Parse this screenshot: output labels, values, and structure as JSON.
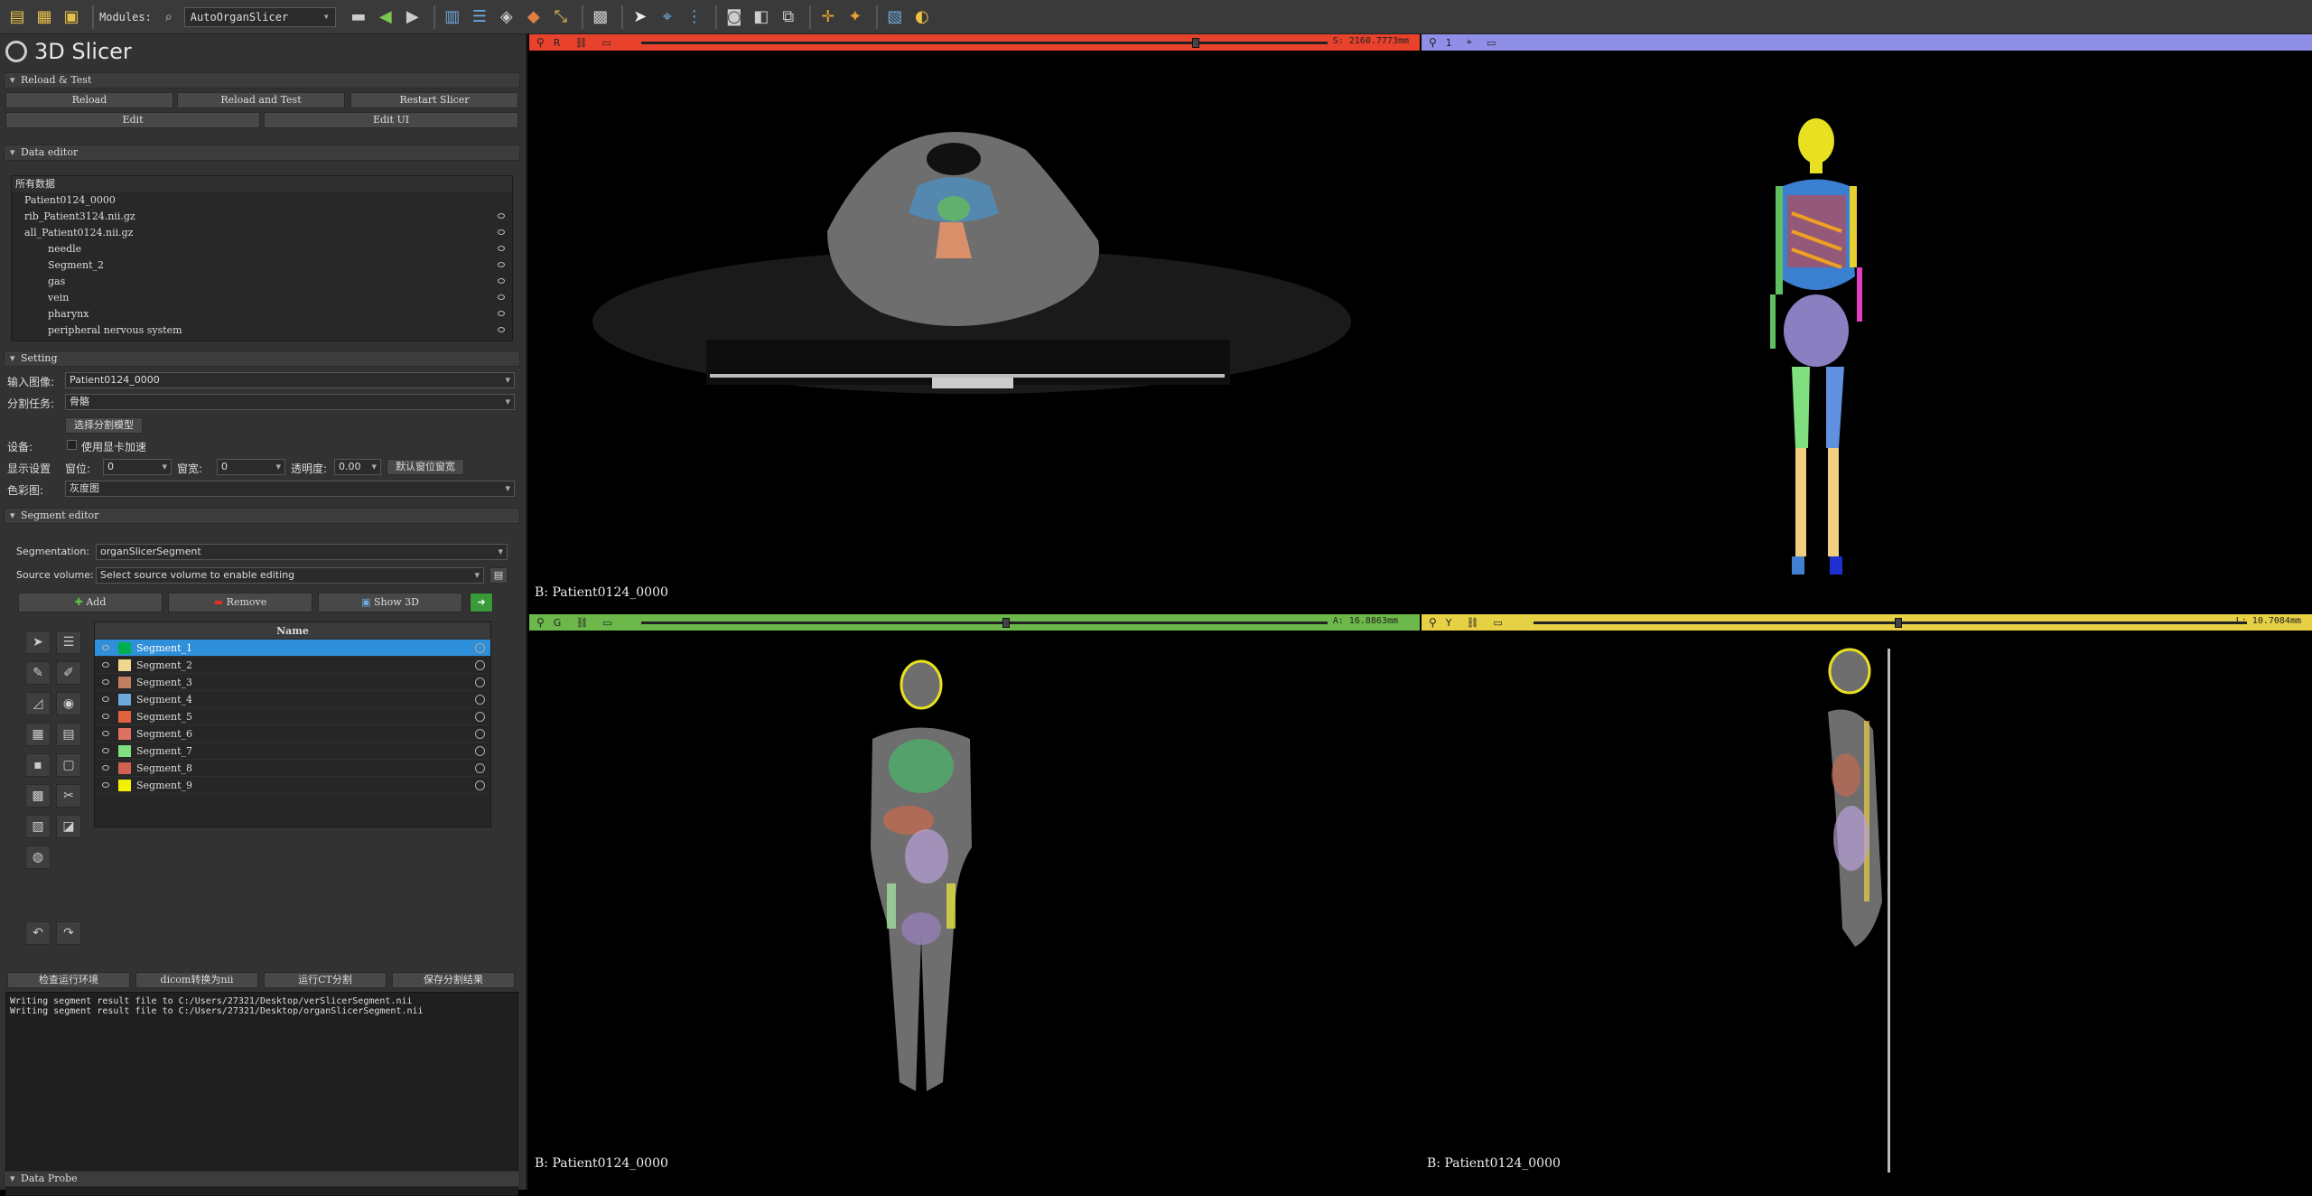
{
  "toolbar": {
    "modules_label": "Modules:",
    "module_name": "AutoOrganSlicer"
  },
  "app": {
    "title": "3D Slicer"
  },
  "reload": {
    "header": "Reload & Test",
    "reload": "Reload",
    "reload_test": "Reload and Test",
    "restart": "Restart Slicer",
    "edit": "Edit",
    "edit_ui": "Edit UI"
  },
  "data_editor": {
    "header": "Data editor",
    "root": "所有数据",
    "items": [
      {
        "label": "Patient0124_0000"
      },
      {
        "label": "rib_Patient3124.nii.gz"
      },
      {
        "label": "all_Patient0124.nii.gz"
      },
      {
        "label": "needle"
      },
      {
        "label": "Segment_2"
      },
      {
        "label": "gas"
      },
      {
        "label": "vein"
      },
      {
        "label": "pharynx"
      },
      {
        "label": "peripheral nervous system"
      }
    ]
  },
  "setting": {
    "header": "Setting",
    "input_label": "输入图像:",
    "input_value": "Patient0124_0000",
    "task_label": "分割任务:",
    "task_value": "骨骼",
    "choose_model": "选择分割模型",
    "device_label": "设备:",
    "gpu_label": "使用显卡加速",
    "display_label": "显示设置",
    "window_level_label": "窗位:",
    "window_level_value": "0",
    "window_width_label": "窗宽:",
    "window_width_value": "0",
    "opacity_label": "透明度:",
    "opacity_value": "0.00",
    "default_btn": "默认窗位窗宽",
    "colormap_label": "色彩图:",
    "colormap_value": "灰度图"
  },
  "segment_editor": {
    "header": "Segment editor",
    "segmentation_label": "Segmentation:",
    "segmentation_value": "organSlicerSegment",
    "source_label": "Source volume:",
    "source_value": "Select source volume to enable editing",
    "add": "Add",
    "remove": "Remove",
    "show3d": "Show 3D",
    "name_col": "Name",
    "segments": [
      {
        "name": "Segment_1",
        "color": "#00b050"
      },
      {
        "name": "Segment_2",
        "color": "#f0d68f"
      },
      {
        "name": "Segment_3",
        "color": "#c08060"
      },
      {
        "name": "Segment_4",
        "color": "#6fa8dc"
      },
      {
        "name": "Segment_5",
        "color": "#e06040"
      },
      {
        "name": "Segment_6",
        "color": "#e07060"
      },
      {
        "name": "Segment_7",
        "color": "#7fdf7f"
      },
      {
        "name": "Segment_8",
        "color": "#d06050"
      },
      {
        "name": "Segment_9",
        "color": "#f2f200"
      }
    ]
  },
  "actions": {
    "check_env": "检查运行环境",
    "dicom": "dicom转换为nii",
    "run_ct": "运行CT分割",
    "save": "保存分割结果"
  },
  "log": [
    "Writing segment result file to C:/Users/27321/Desktop/verSlicerSegment.nii",
    "Writing segment result file to C:/Users/27321/Desktop/organSlicerSegment.nii"
  ],
  "data_probe": "Data Probe",
  "views": {
    "red": {
      "letter": "R",
      "offset": "S: 2160.7773mm",
      "label": "B: Patient0124_0000",
      "color": "#e8412c"
    },
    "threed": {
      "letter": "1",
      "color": "#8f8fe8"
    },
    "green": {
      "letter": "G",
      "offset": "A: 16.8863mm",
      "label": "B: Patient0124_0000",
      "color": "#6cb84a"
    },
    "yellow": {
      "letter": "Y",
      "offset": "L: 10.7084mm",
      "label": "B: Patient0124_0000",
      "color": "#e6d044"
    }
  }
}
